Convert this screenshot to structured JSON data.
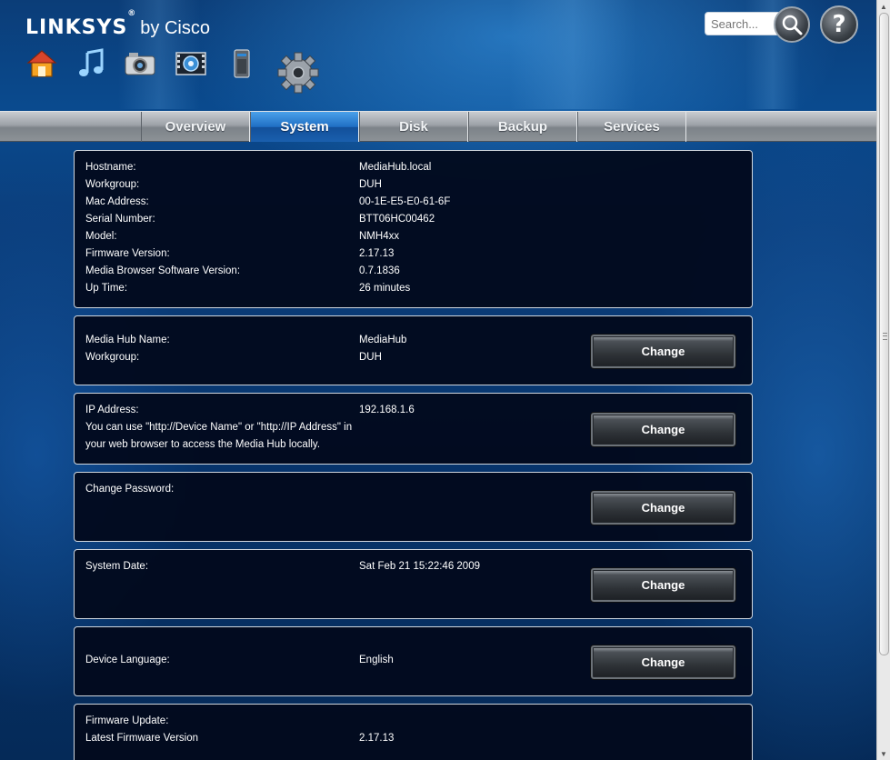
{
  "header": {
    "brand": "LINKSYS",
    "brand_reg": "®",
    "brand_by": "by Cisco",
    "nav_icons": [
      "home-icon",
      "music-icon",
      "photo-camera-icon",
      "video-film-icon",
      "device-icon",
      "settings-gear-icon"
    ],
    "search_placeholder": "Search...",
    "search_icon": "magnifier-icon",
    "help_label": "?"
  },
  "tabs": [
    {
      "label": "Overview",
      "active": false
    },
    {
      "label": "System",
      "active": true
    },
    {
      "label": "Disk",
      "active": false
    },
    {
      "label": "Backup",
      "active": false
    },
    {
      "label": "Services",
      "active": false
    }
  ],
  "info": {
    "rows": [
      {
        "label": "Hostname:",
        "value": "MediaHub.local"
      },
      {
        "label": "Workgroup:",
        "value": "DUH"
      },
      {
        "label": "Mac Address:",
        "value": "00-1E-E5-E0-61-6F"
      },
      {
        "label": "Serial Number:",
        "value": "BTT06HC00462"
      },
      {
        "label": "Model:",
        "value": "NMH4xx"
      },
      {
        "label": "Firmware Version:",
        "value": "2.17.13"
      },
      {
        "label": "Media Browser Software Version:",
        "value": "0.7.1836"
      },
      {
        "label": "Up Time:",
        "value": "26 minutes"
      }
    ]
  },
  "name_panel": {
    "name_label": "Media Hub Name:",
    "name_value": "MediaHub",
    "workgroup_label": "Workgroup:",
    "workgroup_value": "DUH",
    "button": "Change"
  },
  "ip_panel": {
    "label": "IP Address:",
    "value": "192.168.1.6",
    "note_line1": "You can use \"http://Device Name\" or \"http://IP Address\" in",
    "note_line2": "your web browser to access the Media Hub locally.",
    "button": "Change"
  },
  "password_panel": {
    "label": "Change Password:",
    "button": "Change"
  },
  "date_panel": {
    "label": "System Date:",
    "value": "Sat Feb 21 15:22:46 2009",
    "button": "Change"
  },
  "language_panel": {
    "label": "Device Language:",
    "value": "English",
    "button": "Change"
  },
  "firmware_panel": {
    "label": "Firmware Update:",
    "latest_label": "Latest Firmware Version",
    "latest_value": "2.17.13"
  }
}
